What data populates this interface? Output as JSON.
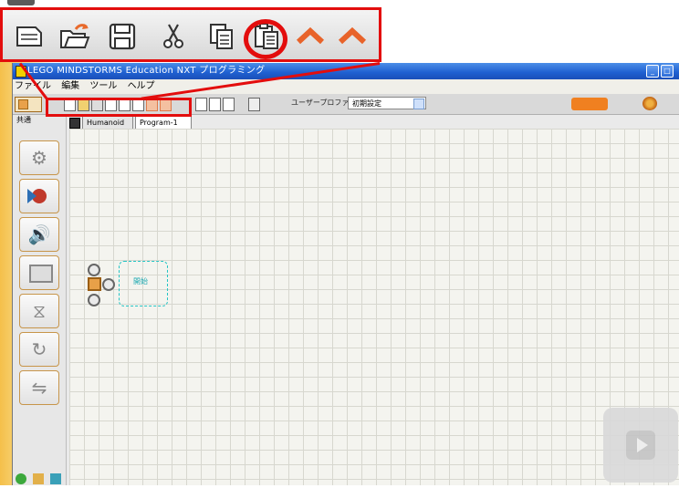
{
  "app": {
    "title": "LEGO MINDSTORMS Education NXT プログラミング",
    "menu": [
      "ファイル",
      "編集",
      "ツール",
      "ヘルプ"
    ],
    "window_buttons": [
      "_",
      "□"
    ]
  },
  "toolbar": {
    "profile_label": "ユーザープロファイル:",
    "profile_value": "初期設定"
  },
  "zoom_toolbar": {
    "buttons": [
      {
        "name": "new-icon",
        "label": "new"
      },
      {
        "name": "open-icon",
        "label": "open"
      },
      {
        "name": "save-icon",
        "label": "save"
      },
      {
        "name": "cut-icon",
        "label": "cut"
      },
      {
        "name": "copy-icon",
        "label": "copy"
      },
      {
        "name": "paste-icon",
        "label": "paste",
        "highlighted": true
      },
      {
        "name": "undo-icon",
        "label": "undo"
      },
      {
        "name": "redo-icon",
        "label": "redo"
      }
    ]
  },
  "tabs": [
    "Humanoid",
    "Program-1"
  ],
  "active_tab": "Program-1",
  "palette": {
    "label": "共通",
    "items": [
      "move-block-icon",
      "record-block-icon",
      "sound-block-icon",
      "display-block-icon",
      "wait-block-icon",
      "loop-block-icon",
      "switch-block-icon"
    ]
  },
  "canvas": {
    "start_label": "開始"
  },
  "colors": {
    "highlight": "#e30d0d",
    "titlebar": "#1f5fd0",
    "palette_border": "#c7954a",
    "start_frame": "#23c4c4"
  }
}
